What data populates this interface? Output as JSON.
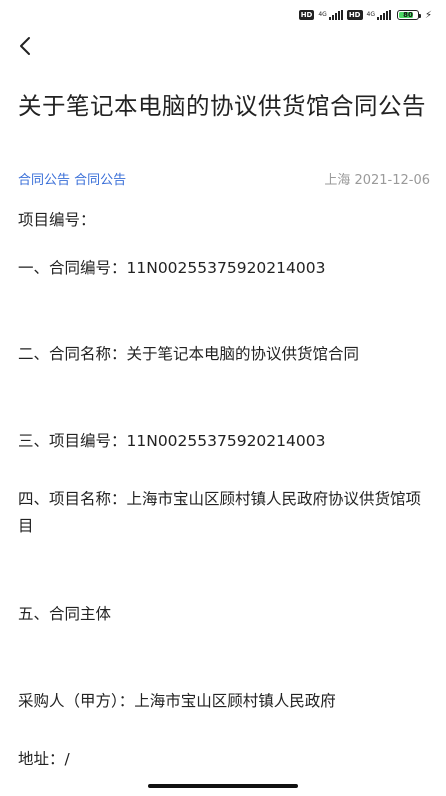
{
  "status_bar": {
    "hd_1": "HD",
    "net_1": "4G",
    "hd_2": "HD",
    "net_2": "4G",
    "battery_level": 0.8,
    "battery_text": "80",
    "charging": "⚡"
  },
  "nav": {
    "back_icon": "chevron-left-icon"
  },
  "article": {
    "title": "关于笔记本电脑的协议供货馆合同公告",
    "tag1": "合同公告",
    "tag2": "合同公告",
    "location_date": "上海 2021-12-06",
    "paragraphs": [
      "项目编号：",
      "一、合同编号：11N00255375920214003",
      "二、合同名称：关于笔记本电脑的协议供货馆合同",
      "三、项目编号：11N00255375920214003",
      "四、项目名称：上海市宝山区顾村镇人民政府协议供货馆项目",
      "五、合同主体",
      "采购人（甲方）：上海市宝山区顾村镇人民政府",
      "地址：/"
    ]
  }
}
